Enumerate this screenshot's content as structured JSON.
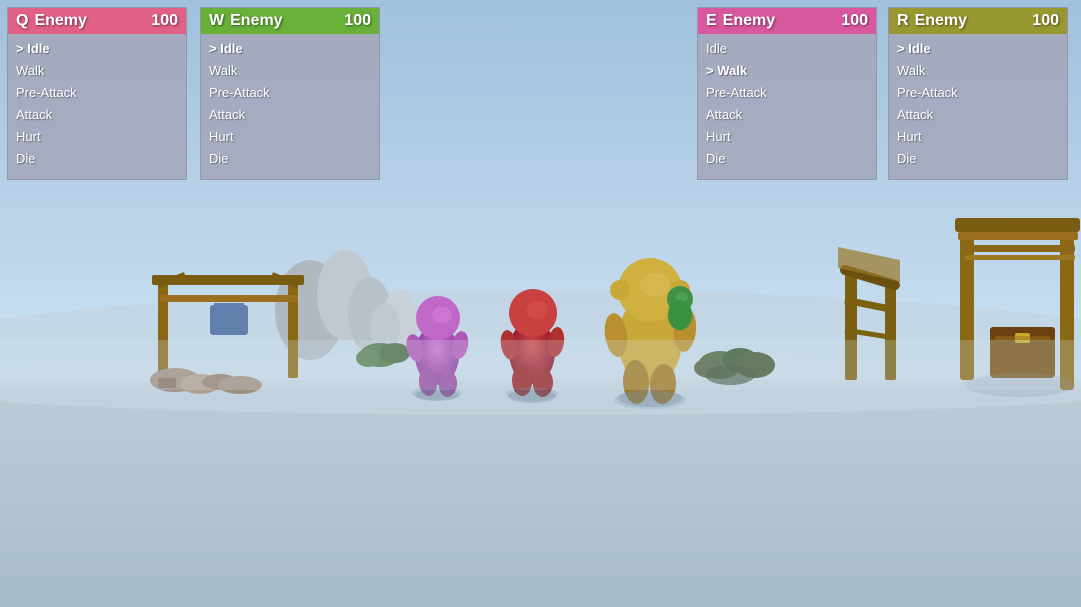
{
  "scene": {
    "background": {
      "sky_top": "#a8c8e0",
      "sky_bottom": "#c8dff0",
      "ground": "#b8ccd8"
    }
  },
  "panels": {
    "q": {
      "key": "Q",
      "name": "Enemy",
      "hp": 100,
      "header_color": "#e06088",
      "states": [
        "Idle",
        "Walk",
        "Pre-Attack",
        "Attack",
        "Hurt",
        "Die"
      ],
      "active_state": "Idle",
      "active_index": 0,
      "active_prefix": "> "
    },
    "w": {
      "key": "W",
      "name": "Enemy",
      "hp": 100,
      "header_color": "#68b038",
      "states": [
        "Idle",
        "Walk",
        "Pre-Attack",
        "Attack",
        "Hurt",
        "Die"
      ],
      "active_state": "Idle",
      "active_index": 0,
      "active_prefix": "> "
    },
    "e": {
      "key": "E",
      "name": "Enemy",
      "hp": 100,
      "header_color": "#d85898",
      "states": [
        "Idle",
        "Walk",
        "Pre-Attack",
        "Attack",
        "Hurt",
        "Die"
      ],
      "active_state": "Walk",
      "active_index": 1,
      "active_prefix": "> "
    },
    "r": {
      "key": "R",
      "name": "Enemy",
      "hp": 100,
      "header_color": "#989830",
      "states": [
        "Idle",
        "Walk",
        "Pre-Attack",
        "Attack",
        "Hurt",
        "Die"
      ],
      "active_state": "Idle",
      "active_index": 0,
      "active_prefix": "> "
    }
  }
}
